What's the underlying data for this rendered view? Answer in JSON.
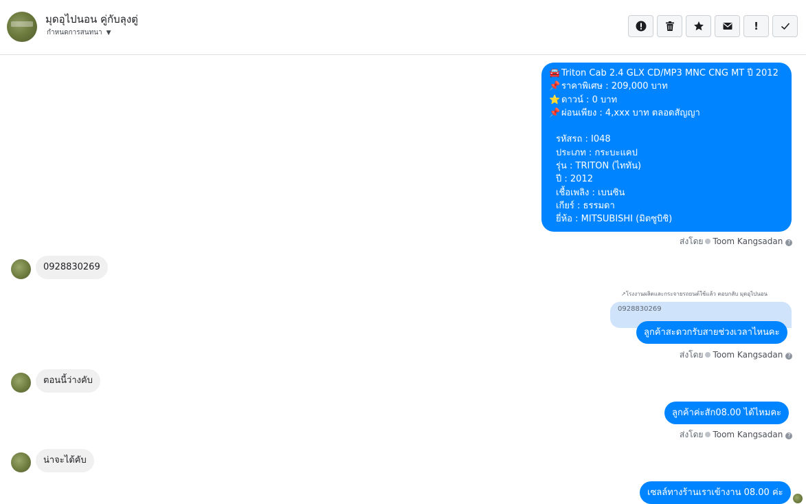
{
  "header": {
    "title": "มุดอุไปนอน คู่กับลุงตู่",
    "subtitle": "กำหนดการสนทนา",
    "toolbar": [
      "report-icon",
      "trash-icon",
      "star-icon",
      "mail-icon",
      "alert-icon",
      "check-icon"
    ]
  },
  "messages": {
    "listing": {
      "lines": [
        {
          "icon": "🚘",
          "text": "Triton Cab 2.4 GLX CD/MP3 MNC  CNG MT ปี 2012"
        },
        {
          "icon": "📌",
          "text": "ราคาพิเศษ : 209,000 บาท"
        },
        {
          "icon": "⭐",
          "text": "ดาวน์ : 0 บาท"
        },
        {
          "icon": "📌",
          "text": "ผ่อนเพียง : 4,xxx บาท ตลอดสัญญา"
        },
        {
          "icon": "",
          "text": ""
        },
        {
          "icon": "",
          "text": "รหัสรถ : I048"
        },
        {
          "icon": "",
          "text": "ประเภท : กระบะแคป"
        },
        {
          "icon": "",
          "text": "รุ่น : TRITON (ไททัน)"
        },
        {
          "icon": "",
          "text": "ปี : 2012"
        },
        {
          "icon": "",
          "text": "เชื้อเพลิง : เบนซิน"
        },
        {
          "icon": "",
          "text": "เกียร์ : ธรรมดา"
        },
        {
          "icon": "",
          "text": "ยี่ห้อ : MITSUBISHI (มิตซูบิชิ)"
        }
      ]
    },
    "sent_by_label": "ส่งโดย",
    "agent_name": "Toom Kangsadan",
    "in1": "0928830269",
    "reply_label": "↗โรงงานผลิตและกระจายรถยนต์ใช้แล้ว ตอบกลับ มุดอุไปนอน",
    "reply_quote": "0928830269",
    "out2": "ลูกค้าสะดวกรับสายช่วงเวลาไหนคะ",
    "in2": "ตอนนี้ว่างคับ",
    "out3": "ลูกค้าค่ะสัก08.00 ได้ไหมคะ",
    "in3": "น่าจะได้คับ",
    "out4": "เซลล์ทางร้านเราเข้างาน 08.00 ค่ะ"
  },
  "colors": {
    "outgoing": "#0084ff",
    "incoming": "#f1f0f0",
    "quote": "#cfe3fb"
  }
}
